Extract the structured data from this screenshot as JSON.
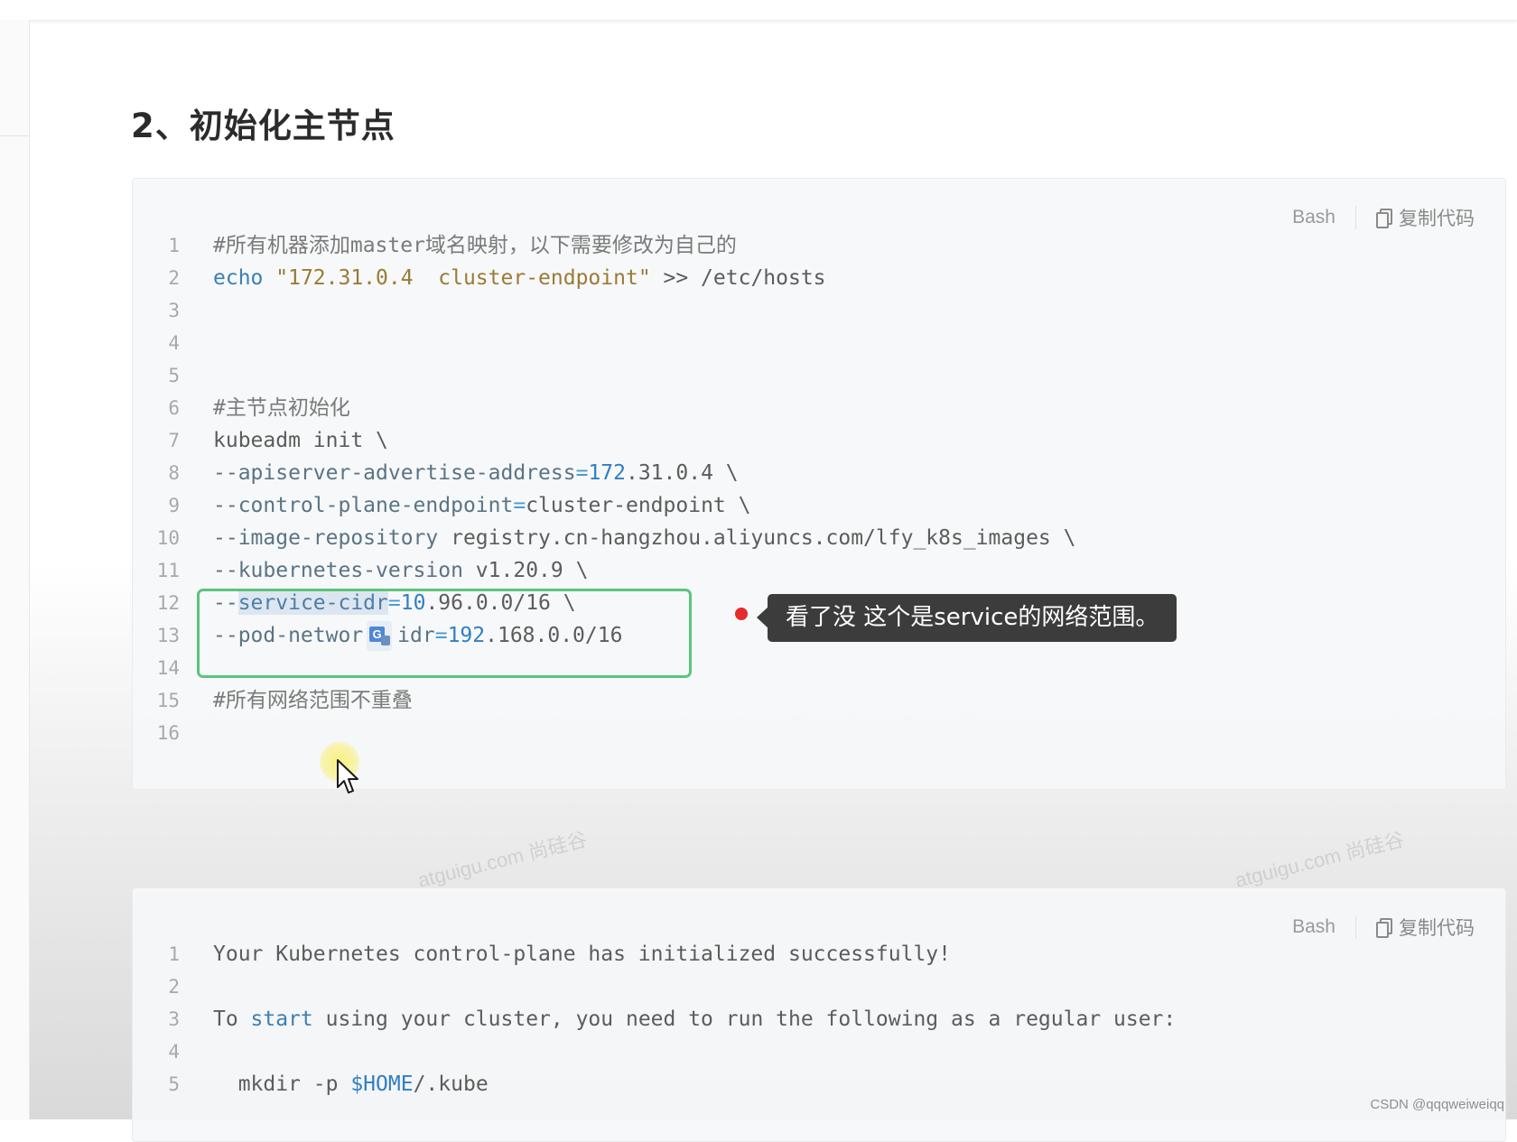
{
  "section_title": "2、初始化主节点",
  "blocks": {
    "first": {
      "language": "Bash",
      "copy_label": "复制代码",
      "lines": {
        "1": {
          "num": "1",
          "comment": "#所有机器添加master域名映射，以下需要修改为自己的"
        },
        "2": {
          "num": "2",
          "kw": "echo",
          "str": "\"172.31.0.4  cluster-endpoint\"",
          "tail": " >> /etc/hosts"
        },
        "3": {
          "num": "3"
        },
        "4": {
          "num": "4"
        },
        "5": {
          "num": "5"
        },
        "6": {
          "num": "6",
          "comment": "#主节点初始化"
        },
        "7": {
          "num": "7",
          "text": "kubeadm init \\"
        },
        "8": {
          "num": "8",
          "flag": "--apiserver-advertise-address",
          "eq": "=",
          "val_num": "172",
          "val_rest": ".31.0.4 \\"
        },
        "9": {
          "num": "9",
          "flag": "--control-plane-endpoint",
          "eq": "=",
          "val_rest": "cluster-endpoint \\"
        },
        "10": {
          "num": "10",
          "flag": "--image-repository",
          "val_rest": " registry.cn-hangzhou.aliyuncs.com/lfy_k8s_images \\"
        },
        "11": {
          "num": "11",
          "flag": "--kubernetes-version",
          "val_rest": " v1.20.9 \\"
        },
        "12": {
          "num": "12",
          "prefix": "--",
          "selected": "service-cidr",
          "eq": "=",
          "val_num": "10",
          "val_rest": ".96.0.0/16 \\"
        },
        "13": {
          "num": "13",
          "flag_a": "--pod-networ",
          "flag_b": "idr",
          "eq": "=",
          "val_num": "192",
          "val_rest": ".168.0.0/16"
        },
        "14": {
          "num": "14"
        },
        "15": {
          "num": "15",
          "comment": "#所有网络范围不重叠"
        },
        "16": {
          "num": "16"
        }
      }
    },
    "second": {
      "language": "Bash",
      "copy_label": "复制代码",
      "lines": {
        "1": {
          "num": "1",
          "text": "Your Kubernetes control-plane has initialized successfully!"
        },
        "2": {
          "num": "2"
        },
        "3": {
          "num": "3",
          "a": "To ",
          "kw": "start",
          "b": " using your cluster, you need to run the following as a regular user:"
        },
        "4": {
          "num": "4"
        },
        "5": {
          "num": "5",
          "a": "  mkdir -p ",
          "var": "$HOME",
          "b": "/.kube"
        }
      }
    }
  },
  "annotation": {
    "text": "看了没 这个是service的网络范围。"
  },
  "translate_badge_glyph": "G",
  "watermark_text": "atguigu.com 尚硅谷",
  "credit": "CSDN @qqqweiweiqq",
  "colors": {
    "highlight_border": "#5cc47d",
    "annotation_dot": "#e52b2b",
    "annotation_bg": "#3c3c3c",
    "keyword": "#3b7fb5",
    "string": "#9b7a36",
    "number": "#2f7fc4"
  },
  "icons": {
    "copy": "copy-icon",
    "cursor": "mouse-pointer-icon",
    "translate": "google-translate-icon"
  }
}
